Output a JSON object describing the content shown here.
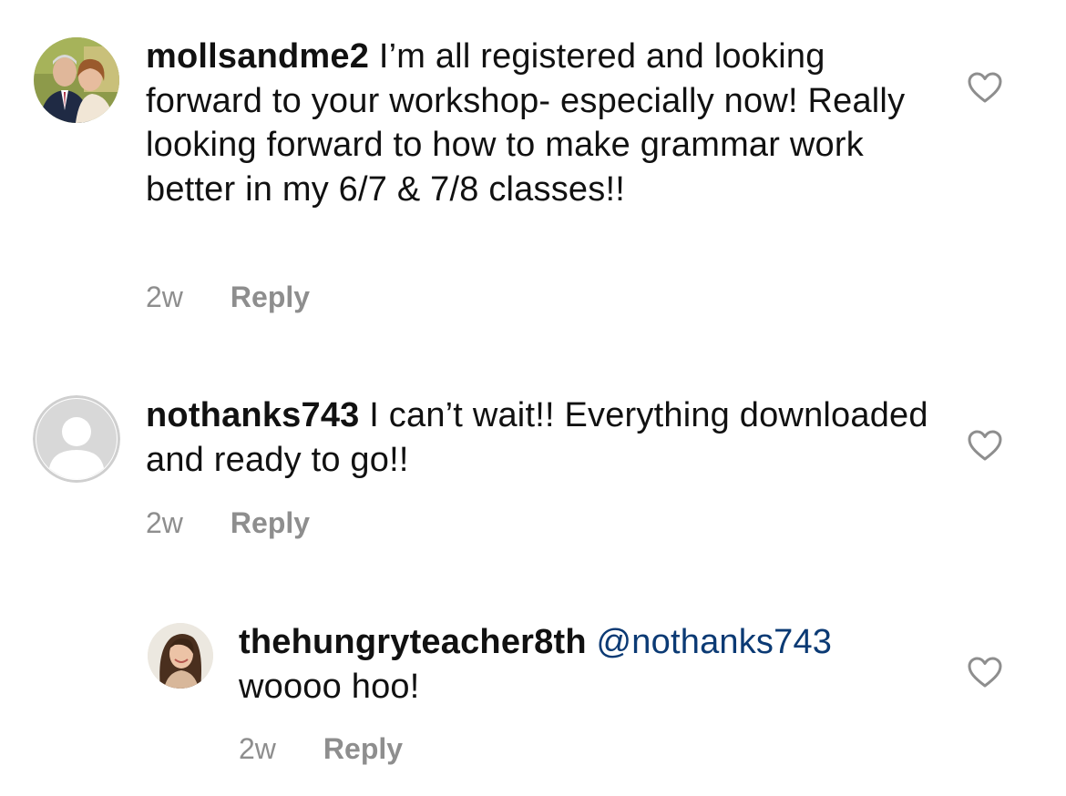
{
  "comments": [
    {
      "username": "mollsandme2",
      "mention": "",
      "text": "I’m all registered and looking forward to your workshop- especially now! Really looking forward to how to make grammar work better in my 6/7 & 7/8 classes!!",
      "time": "2w",
      "reply_label": "Reply",
      "avatar": "photo-couple",
      "like_icon": "heart-outline-icon"
    },
    {
      "username": "nothanks743",
      "mention": "",
      "text": "I can’t wait!! Everything downloaded and ready to go!!",
      "time": "2w",
      "reply_label": "Reply",
      "avatar": "default-user-placeholder",
      "like_icon": "heart-outline-icon"
    },
    {
      "username": "thehungryteacher8th",
      "mention": "@nothanks743",
      "text": "woooo hoo!",
      "time": "2w",
      "reply_label": "Reply",
      "avatar": "photo-woman",
      "like_icon": "heart-outline-icon"
    }
  ],
  "colors": {
    "text": "#111111",
    "meta": "#8e8e8e",
    "mention": "#0b3a74",
    "placeholder_avatar": "#d6d6d6"
  }
}
